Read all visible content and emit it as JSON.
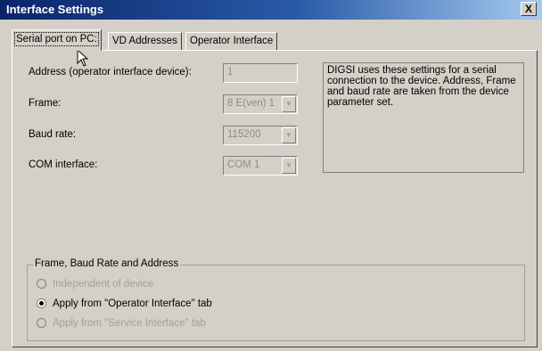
{
  "window": {
    "title": "Interface Settings",
    "close_label": "X"
  },
  "tabs": [
    {
      "label": "Serial port on PC:",
      "active": true
    },
    {
      "label": "VD Addresses",
      "active": false
    },
    {
      "label": "Operator Interface",
      "active": false
    }
  ],
  "form": {
    "address": {
      "label": "Address (operator interface device):",
      "value": "1"
    },
    "frame": {
      "label": "Frame:",
      "value": "8 E(ven) 1"
    },
    "baud_rate": {
      "label": "Baud rate:",
      "value": "115200"
    },
    "com_interface": {
      "label": "COM interface:",
      "value": "COM 1"
    }
  },
  "info_text": "DIGSI uses these settings for a serial connection to the device. Address, Frame and baud rate are taken from the device parameter set.",
  "group": {
    "title": "Frame, Baud Rate and Address",
    "options": [
      {
        "label": "Independent of device",
        "checked": false,
        "enabled": false
      },
      {
        "label": "Apply from \"Operator Interface\" tab",
        "checked": true,
        "enabled": true
      },
      {
        "label": "Apply from \"Service Interface\" tab",
        "checked": false,
        "enabled": false
      }
    ]
  }
}
